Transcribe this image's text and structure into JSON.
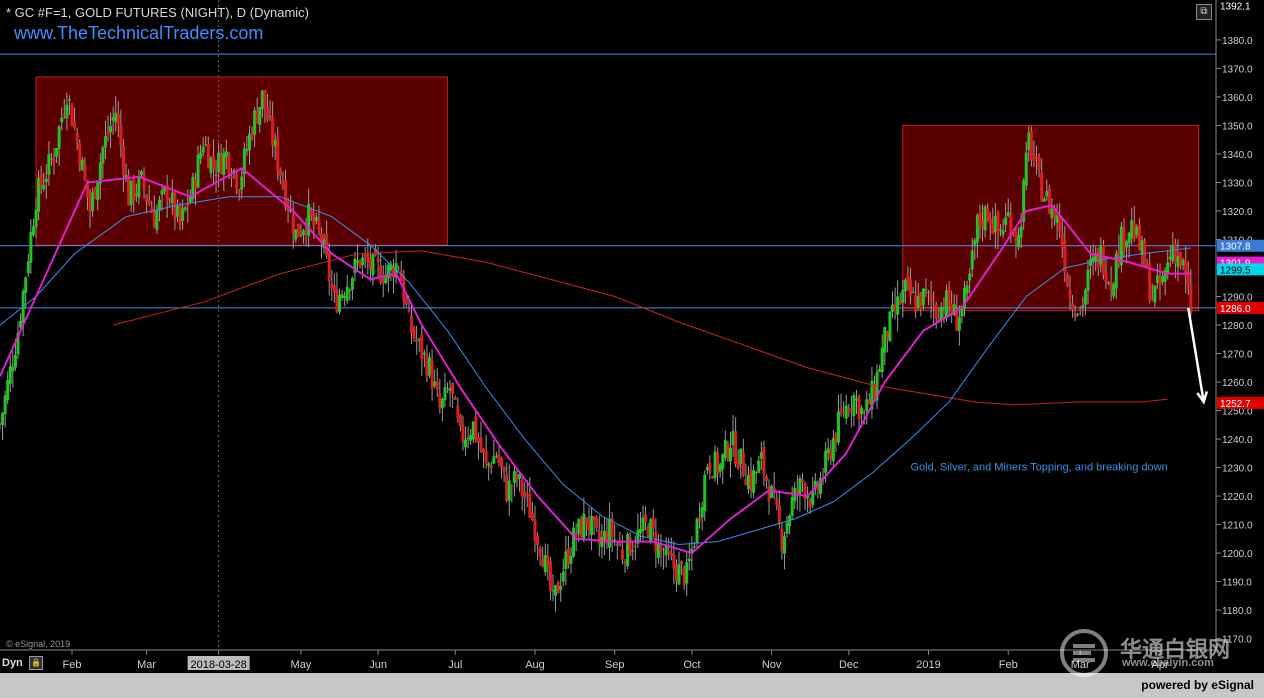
{
  "header": {
    "title": "* GC #F=1, GOLD FUTURES (NIGHT), D (Dynamic)",
    "website": "www.TheTechnicalTraders.com"
  },
  "footer": {
    "copyright": "© eSignal, 2019",
    "powered": "powered by eSignal",
    "dyn_label": "Dyn",
    "lock_icon": "lock-icon"
  },
  "watermark": {
    "chinese": "华通白银网",
    "url": "www.ebaiyin.com"
  },
  "chart_data": {
    "type": "candlestick",
    "title": "* GC #F=1, GOLD FUTURES (NIGHT), D (Dynamic)",
    "ylim": [
      1166,
      1394
    ],
    "y_ticks": [
      1170,
      1180,
      1190,
      1200,
      1210,
      1220,
      1230,
      1240,
      1250,
      1260,
      1270,
      1280,
      1290,
      1300,
      1310,
      1320,
      1330,
      1340,
      1350,
      1360,
      1370,
      1380
    ],
    "y_tick_labels": [
      "1170.0",
      "1180.0",
      "1190.0",
      "1200.0",
      "1210.0",
      "1220.0",
      "1230.0",
      "1240.0",
      "1250.0",
      "1260.0",
      "1270.0",
      "1280.0",
      "1290.0",
      "1300.0",
      "1310.0",
      "1320.0",
      "1330.0",
      "1340.0",
      "1350.0",
      "1360.0",
      "1370.0",
      "1380.0"
    ],
    "x_labels": [
      {
        "label": "Feb",
        "day": 29
      },
      {
        "label": "Mar",
        "day": 58
      },
      {
        "label": "2018-03-28",
        "day": 86,
        "highlight": true
      },
      {
        "label": "May",
        "day": 118
      },
      {
        "label": "Jun",
        "day": 148
      },
      {
        "label": "Jul",
        "day": 178
      },
      {
        "label": "Aug",
        "day": 209
      },
      {
        "label": "Sep",
        "day": 240
      },
      {
        "label": "Oct",
        "day": 270
      },
      {
        "label": "Nov",
        "day": 301
      },
      {
        "label": "Dec",
        "day": 331
      },
      {
        "label": "2019",
        "day": 362
      },
      {
        "label": "Feb",
        "day": 393
      },
      {
        "label": "Mar",
        "day": 421
      },
      {
        "label": "Apr",
        "day": 452
      }
    ],
    "day_range": [
      1,
      473
    ],
    "price_path": [
      [
        1,
        1245
      ],
      [
        8,
        1278
      ],
      [
        15,
        1325
      ],
      [
        22,
        1340
      ],
      [
        27,
        1362
      ],
      [
        32,
        1340
      ],
      [
        36,
        1320
      ],
      [
        41,
        1342
      ],
      [
        46,
        1355
      ],
      [
        51,
        1325
      ],
      [
        56,
        1330
      ],
      [
        61,
        1318
      ],
      [
        66,
        1327
      ],
      [
        71,
        1315
      ],
      [
        76,
        1328
      ],
      [
        80,
        1345
      ],
      [
        84,
        1335
      ],
      [
        89,
        1340
      ],
      [
        94,
        1330
      ],
      [
        99,
        1350
      ],
      [
        103,
        1360
      ],
      [
        107,
        1345
      ],
      [
        111,
        1330
      ],
      [
        116,
        1312
      ],
      [
        121,
        1318
      ],
      [
        126,
        1310
      ],
      [
        131,
        1288
      ],
      [
        136,
        1295
      ],
      [
        141,
        1303
      ],
      [
        146,
        1300
      ],
      [
        151,
        1298
      ],
      [
        156,
        1302
      ],
      [
        160,
        1280
      ],
      [
        164,
        1272
      ],
      [
        168,
        1265
      ],
      [
        172,
        1250
      ],
      [
        176,
        1258
      ],
      [
        180,
        1240
      ],
      [
        185,
        1245
      ],
      [
        190,
        1230
      ],
      [
        194,
        1235
      ],
      [
        198,
        1222
      ],
      [
        202,
        1226
      ],
      [
        207,
        1215
      ],
      [
        212,
        1200
      ],
      [
        216,
        1182
      ],
      [
        220,
        1195
      ],
      [
        224,
        1205
      ],
      [
        229,
        1212
      ],
      [
        234,
        1203
      ],
      [
        238,
        1208
      ],
      [
        243,
        1200
      ],
      [
        248,
        1205
      ],
      [
        253,
        1210
      ],
      [
        258,
        1200
      ],
      [
        263,
        1195
      ],
      [
        268,
        1192
      ],
      [
        272,
        1210
      ],
      [
        276,
        1232
      ],
      [
        281,
        1230
      ],
      [
        285,
        1240
      ],
      [
        289,
        1232
      ],
      [
        293,
        1225
      ],
      [
        297,
        1232
      ],
      [
        301,
        1220
      ],
      [
        305,
        1205
      ],
      [
        309,
        1218
      ],
      [
        313,
        1225
      ],
      [
        317,
        1218
      ],
      [
        321,
        1228
      ],
      [
        325,
        1240
      ],
      [
        329,
        1250
      ],
      [
        333,
        1255
      ],
      [
        337,
        1248
      ],
      [
        341,
        1258
      ],
      [
        345,
        1275
      ],
      [
        349,
        1285
      ],
      [
        353,
        1292
      ],
      [
        357,
        1288
      ],
      [
        361,
        1290
      ],
      [
        365,
        1285
      ],
      [
        369,
        1288
      ],
      [
        373,
        1282
      ],
      [
        377,
        1290
      ],
      [
        381,
        1315
      ],
      [
        385,
        1320
      ],
      [
        389,
        1312
      ],
      [
        393,
        1318
      ],
      [
        397,
        1310
      ],
      [
        401,
        1345
      ],
      [
        405,
        1330
      ],
      [
        409,
        1322
      ],
      [
        413,
        1315
      ],
      [
        417,
        1290
      ],
      [
        421,
        1285
      ],
      [
        425,
        1300
      ],
      [
        429,
        1305
      ],
      [
        433,
        1295
      ],
      [
        437,
        1310
      ],
      [
        441,
        1315
      ],
      [
        445,
        1305
      ],
      [
        449,
        1290
      ],
      [
        453,
        1295
      ],
      [
        457,
        1308
      ],
      [
        461,
        1300
      ],
      [
        463,
        1290
      ],
      [
        464,
        1286
      ]
    ],
    "ma_fast_path": [
      [
        1,
        1262
      ],
      [
        20,
        1300
      ],
      [
        35,
        1330
      ],
      [
        55,
        1332
      ],
      [
        75,
        1325
      ],
      [
        95,
        1335
      ],
      [
        115,
        1320
      ],
      [
        130,
        1305
      ],
      [
        145,
        1296
      ],
      [
        155,
        1298
      ],
      [
        165,
        1280
      ],
      [
        180,
        1258
      ],
      [
        195,
        1238
      ],
      [
        210,
        1220
      ],
      [
        225,
        1205
      ],
      [
        240,
        1204
      ],
      [
        255,
        1204
      ],
      [
        270,
        1200
      ],
      [
        285,
        1212
      ],
      [
        300,
        1222
      ],
      [
        315,
        1220
      ],
      [
        330,
        1235
      ],
      [
        345,
        1260
      ],
      [
        360,
        1278
      ],
      [
        375,
        1286
      ],
      [
        390,
        1306
      ],
      [
        400,
        1320
      ],
      [
        410,
        1322
      ],
      [
        425,
        1305
      ],
      [
        440,
        1302
      ],
      [
        455,
        1298
      ],
      [
        464,
        1298
      ]
    ],
    "ma_mid_path": [
      [
        1,
        1280
      ],
      [
        15,
        1290
      ],
      [
        30,
        1305
      ],
      [
        50,
        1318
      ],
      [
        70,
        1322
      ],
      [
        90,
        1325
      ],
      [
        110,
        1325
      ],
      [
        130,
        1318
      ],
      [
        145,
        1308
      ],
      [
        160,
        1295
      ],
      [
        175,
        1278
      ],
      [
        190,
        1258
      ],
      [
        205,
        1240
      ],
      [
        220,
        1224
      ],
      [
        235,
        1213
      ],
      [
        250,
        1206
      ],
      [
        265,
        1203
      ],
      [
        280,
        1204
      ],
      [
        295,
        1208
      ],
      [
        310,
        1212
      ],
      [
        325,
        1218
      ],
      [
        340,
        1228
      ],
      [
        355,
        1240
      ],
      [
        370,
        1253
      ],
      [
        385,
        1272
      ],
      [
        400,
        1290
      ],
      [
        415,
        1300
      ],
      [
        430,
        1303
      ],
      [
        445,
        1305
      ],
      [
        464,
        1307
      ]
    ],
    "ma_slow_path": [
      [
        45,
        1280
      ],
      [
        80,
        1288
      ],
      [
        110,
        1298
      ],
      [
        140,
        1305
      ],
      [
        165,
        1306
      ],
      [
        190,
        1302
      ],
      [
        215,
        1296
      ],
      [
        240,
        1290
      ],
      [
        265,
        1281
      ],
      [
        290,
        1273
      ],
      [
        315,
        1265
      ],
      [
        340,
        1259
      ],
      [
        360,
        1256
      ],
      [
        380,
        1253
      ],
      [
        395,
        1252
      ],
      [
        420,
        1253
      ],
      [
        445,
        1253
      ],
      [
        455,
        1254
      ]
    ],
    "h_lines": [
      1375.0,
      1307.8,
      1286.0
    ],
    "boxes": [
      {
        "from_day": 15,
        "to_day": 175,
        "top": 1367,
        "bottom": 1308
      },
      {
        "from_day": 352,
        "to_day": 467,
        "top": 1350,
        "bottom": 1285
      }
    ],
    "price_labels": [
      {
        "value": "1392.1",
        "price": 1392.1,
        "bg": "#000000",
        "fg": "#ffffff"
      },
      {
        "value": "1307.8",
        "price": 1307.8,
        "bg": "#3a7bd5",
        "fg": "#ffffff"
      },
      {
        "value": "1301.9",
        "price": 1301.9,
        "bg": "#e020d0",
        "fg": "#ffffff"
      },
      {
        "value": "1299.5",
        "price": 1299.5,
        "bg": "#00d8e8",
        "fg": "#000000"
      },
      {
        "value": "1286.0",
        "price": 1286.0,
        "bg": "#e00000",
        "fg": "#ffffff"
      },
      {
        "value": "1252.7",
        "price": 1252.7,
        "bg": "#e00000",
        "fg": "#ffffff"
      }
    ],
    "annotation": {
      "text": "Gold, Silver, and Miners Topping, and breaking down",
      "day": 355,
      "price": 1229
    },
    "arrows": [
      {
        "from_day": 463,
        "from_price": 1286,
        "to_day": 469,
        "to_price": 1253
      },
      {
        "from_day": 477,
        "from_price": 1262,
        "to_day": 487,
        "to_price": 1221
      }
    ],
    "grid": false,
    "colors": {
      "background": "#000000",
      "up": "#22c422",
      "down": "#d82020",
      "ma_fast": "#e020d0",
      "ma_mid": "#3a8ee8",
      "ma_slow": "#d02020",
      "h_line": "#4a90e8",
      "box_fill": "#5a0000",
      "box_stroke": "#c02020",
      "axis_text": "#cfcfcf",
      "annotation": "#3a8ee8"
    }
  }
}
